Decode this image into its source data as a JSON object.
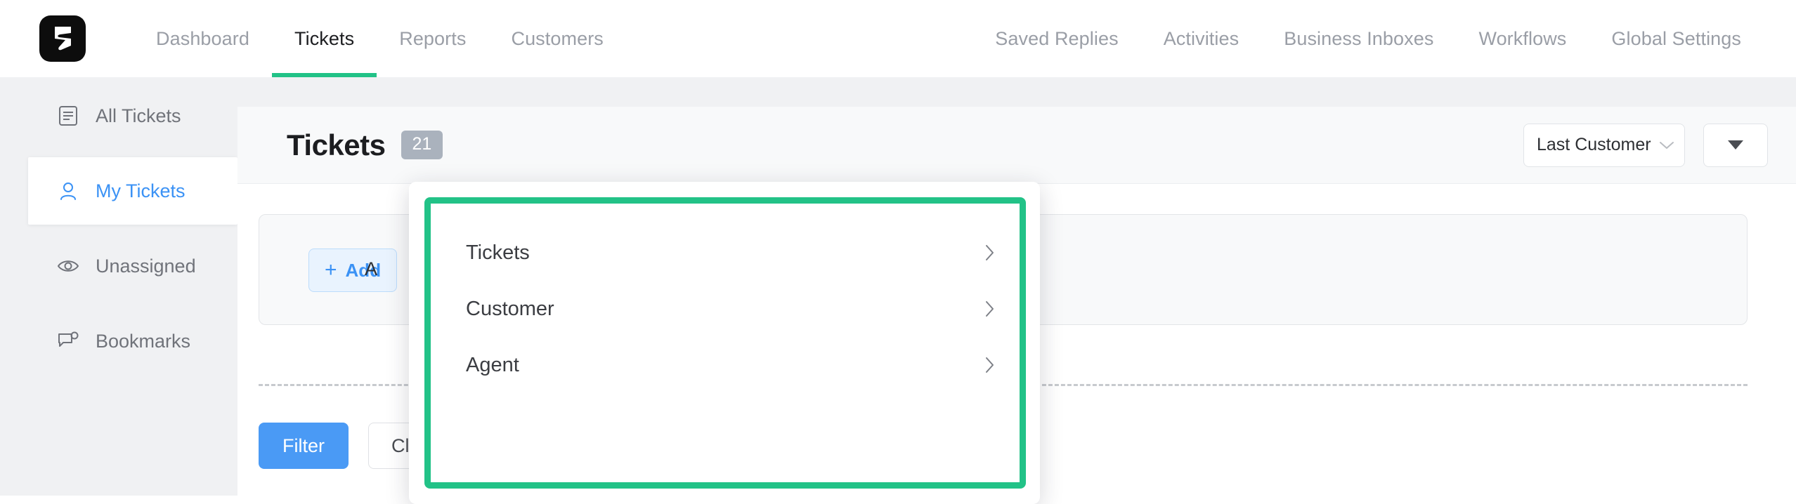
{
  "topnav": {
    "logo_icon": "flowchart-logo-icon",
    "left_items": [
      {
        "label": "Dashboard",
        "active": false
      },
      {
        "label": "Tickets",
        "active": true
      },
      {
        "label": "Reports",
        "active": false
      },
      {
        "label": "Customers",
        "active": false
      }
    ],
    "right_items": [
      {
        "label": "Saved Replies"
      },
      {
        "label": "Activities"
      },
      {
        "label": "Business Inboxes"
      },
      {
        "label": "Workflows"
      },
      {
        "label": "Global Settings"
      }
    ],
    "active_underline_color": "#22c287"
  },
  "sidebar": {
    "items": [
      {
        "label": "All Tickets",
        "icon": "document-list-icon",
        "selected": false
      },
      {
        "label": "My Tickets",
        "icon": "person-icon",
        "selected": true
      },
      {
        "label": "Unassigned",
        "icon": "eye-icon",
        "selected": false
      },
      {
        "label": "Bookmarks",
        "icon": "comment-tag-icon",
        "selected": false
      }
    ],
    "selected_color": "#3b92f5"
  },
  "page": {
    "title": "Tickets",
    "count_badge": "21",
    "sort_select": {
      "value": "Last Customer Response",
      "icon": "chevron-down-icon"
    },
    "view_select": {
      "icon": "caret-down-icon"
    }
  },
  "filter_card": {
    "add_button": {
      "plus": "+",
      "label": "Add"
    },
    "trailing_text": "A"
  },
  "actions": {
    "filter_label": "Filter",
    "clear_label": "Clear Filters",
    "primary_color": "#4a9af5"
  },
  "popover": {
    "highlight_color": "#22c287",
    "items": [
      {
        "label": "Tickets",
        "icon": "chevron-right-icon"
      },
      {
        "label": "Customer",
        "icon": "chevron-right-icon"
      },
      {
        "label": "Agent",
        "icon": "chevron-right-icon"
      }
    ]
  }
}
